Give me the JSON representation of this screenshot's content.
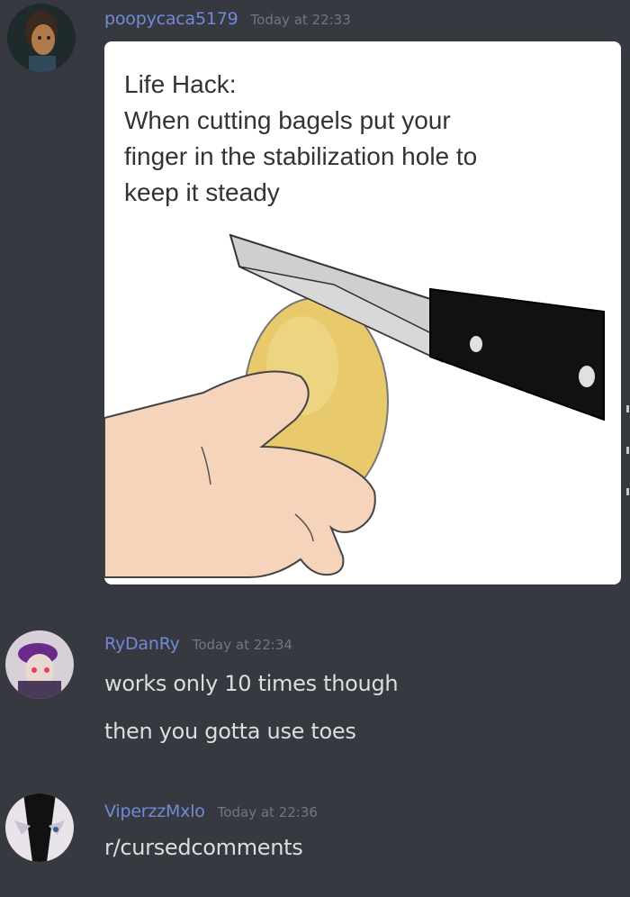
{
  "colors": {
    "background": "#36393f",
    "user1": "#7289da",
    "user2": "#7289da",
    "user3": "#7289da",
    "timestamp": "#72767d",
    "message_text": "#dcddde"
  },
  "messages": [
    {
      "username": "poopycaca5179",
      "timestamp": "Today at 22:33",
      "attachment": {
        "caption_lines": [
          "Life Hack:",
          "When cutting bagels put your",
          "finger in the stabilization hole to",
          "keep it steady"
        ],
        "illustration": "hand-cutting-bagel-with-knife"
      }
    },
    {
      "username": "RyDanRy",
      "timestamp": "Today at 22:34",
      "lines": [
        "works only 10 times though",
        "then you gotta use toes"
      ]
    },
    {
      "username": "ViperzzMxlo",
      "timestamp": "Today at 22:36",
      "lines": [
        "r/cursedcomments"
      ]
    }
  ]
}
